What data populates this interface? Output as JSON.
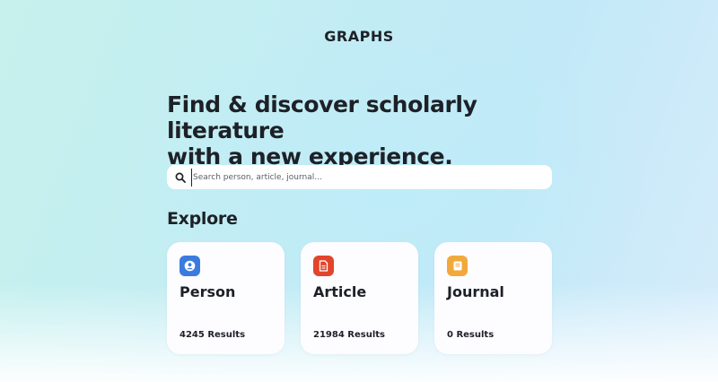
{
  "brand": "GRAPHS",
  "hero": {
    "line1": "Find & discover scholarly literature",
    "line2": "with a new experience."
  },
  "search": {
    "placeholder": "Search person, article, journal...",
    "value": "",
    "icon": "search-icon"
  },
  "explore": {
    "title": "Explore",
    "cards": [
      {
        "title": "Person",
        "count_label": "4245 Results",
        "count": 4245,
        "icon": "person-icon",
        "icon_color": "#3b7be0"
      },
      {
        "title": "Article",
        "count_label": "21984 Results",
        "count": 21984,
        "icon": "document-icon",
        "icon_color": "#e2452b"
      },
      {
        "title": "Journal",
        "count_label": "0 Results",
        "count": 0,
        "icon": "book-icon",
        "icon_color": "#f2a93b"
      }
    ]
  },
  "colors": {
    "text": "#1d2127",
    "card_bg": "#fdfcff",
    "bg_left": "#c6f1ec",
    "bg_right": "#d6ecfb"
  }
}
